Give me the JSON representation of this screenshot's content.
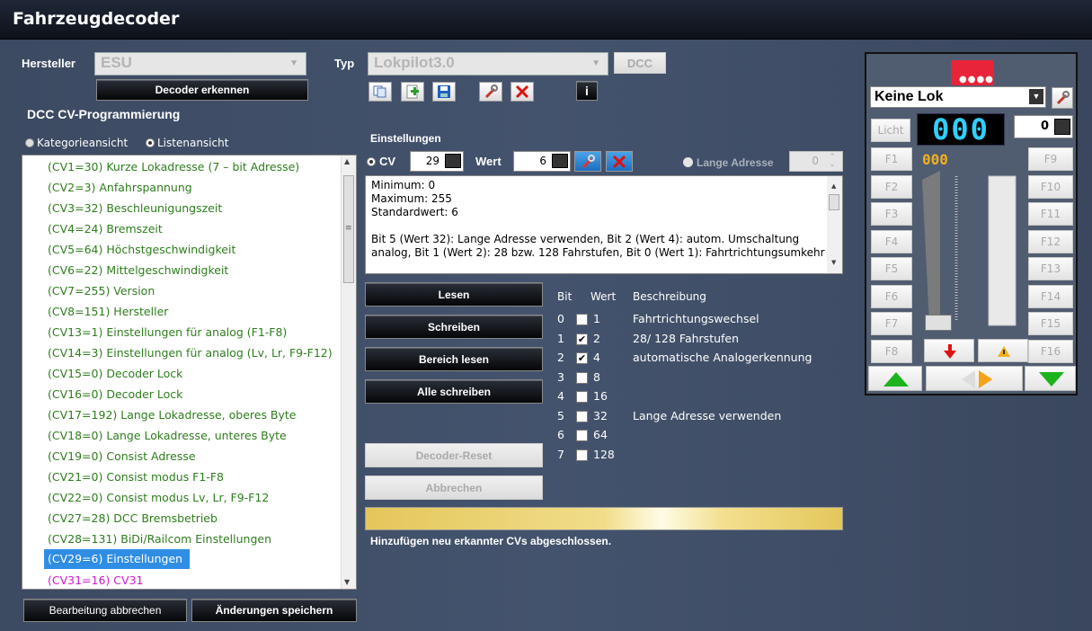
{
  "window": {
    "title": "Fahrzeugdecoder"
  },
  "header": {
    "hersteller_label": "Hersteller",
    "hersteller_value": "ESU",
    "typ_label": "Typ",
    "typ_value": "Lokpilot3.0",
    "protocol_button": "DCC",
    "detect_button": "Decoder erkennen",
    "section_title": "DCC CV-Programmierung",
    "info_button": "i"
  },
  "view_mode": {
    "option_category": "Kategorieansicht",
    "option_list": "Listenansicht",
    "selected": "Listenansicht"
  },
  "cv_list": [
    "(CV1=30) Kurze Lokadresse (7 – bit Adresse)",
    "(CV2=3) Anfahrspannung",
    "(CV3=32) Beschleunigungszeit",
    "(CV4=24) Bremszeit",
    "(CV5=64) Höchstgeschwindigkeit",
    "(CV6=22) Mittelgeschwindigkeit",
    "(CV7=255) Version",
    "(CV8=151) Hersteller",
    "(CV13=1) Einstellungen für analog (F1-F8)",
    "(CV14=3) Einstellungen für analog (Lv, Lr, F9-F12)",
    "(CV15=0) Decoder Lock",
    "(CV16=0) Decoder Lock",
    "(CV17=192) Lange Lokadresse, oberes Byte",
    "(CV18=0) Lange Lokadresse, unteres Byte",
    "(CV19=0) Consist Adresse",
    "(CV21=0) Consist modus F1-F8",
    "(CV22=0) Consist modus Lv, Lr, F9-F12",
    "(CV27=28) DCC Bremsbetrieb",
    "(CV28=131) BiDi/Railcom Einstellungen",
    "(CV29=6) Einstellungen",
    "(CV31=16) CV31"
  ],
  "cv_list_selected": "(CV29=6) Einstellungen",
  "bottom_buttons": {
    "cancel": "Bearbeitung abbrechen",
    "save": "Änderungen speichern"
  },
  "settings": {
    "title": "Einstellungen",
    "cv_label": "CV",
    "cv_value": "29",
    "wert_label": "Wert",
    "wert_value": "6",
    "long_address_label": "Lange Adresse",
    "long_address_value": "0"
  },
  "info_text": {
    "line1": "Minimum: 0",
    "line2": "Maximum: 255",
    "line3": "Standardwert: 6",
    "line4": "Bit 5 (Wert 32): Lange Adresse verwenden, Bit 2 (Wert 4): autom. Umschaltung",
    "line5": "analog, Bit 1 (Wert 2): 28 bzw. 128 Fahrstufen, Bit 0 (Wert 1): Fahrtrichtungsumkehr"
  },
  "actions": {
    "read": "Lesen",
    "write": "Schreiben",
    "read_range": "Bereich lesen",
    "write_all": "Alle schreiben",
    "decoder_reset": "Decoder-Reset",
    "abort": "Abbrechen"
  },
  "bit_table": {
    "headers": {
      "bit": "Bit",
      "wert": "Wert",
      "beschreibung": "Beschreibung"
    },
    "rows": [
      {
        "bit": "0",
        "wert": "1",
        "checked": false,
        "desc": "Fahrtrichtungswechsel"
      },
      {
        "bit": "1",
        "wert": "2",
        "checked": true,
        "desc": "28/ 128 Fahrstufen"
      },
      {
        "bit": "2",
        "wert": "4",
        "checked": true,
        "desc": "automatische Analogerkennung"
      },
      {
        "bit": "3",
        "wert": "8",
        "checked": false,
        "desc": ""
      },
      {
        "bit": "4",
        "wert": "16",
        "checked": false,
        "desc": ""
      },
      {
        "bit": "5",
        "wert": "32",
        "checked": false,
        "desc": "Lange Adresse verwenden"
      },
      {
        "bit": "6",
        "wert": "64",
        "checked": false,
        "desc": ""
      },
      {
        "bit": "7",
        "wert": "128",
        "checked": false,
        "desc": ""
      }
    ]
  },
  "status": {
    "message": "Hinzufügen neu erkannter CVs abgeschlossen."
  },
  "throttle": {
    "loco": "Keine Lok",
    "light": "Licht",
    "address_display": "000",
    "speed_steps_value": "0",
    "speed_display": "000",
    "functions_left": [
      "F1",
      "F2",
      "F3",
      "F4",
      "F5",
      "F6",
      "F7",
      "F8"
    ],
    "functions_right": [
      "F9",
      "F10",
      "F11",
      "F12",
      "F13",
      "F14",
      "F15",
      "F16"
    ],
    "speed_level": 0,
    "colors": {
      "accent_red": "#e8243a",
      "led_cyan": "#2fd0ff",
      "led_amber": "#f0b020",
      "arrow_green": "#1db31d"
    }
  }
}
